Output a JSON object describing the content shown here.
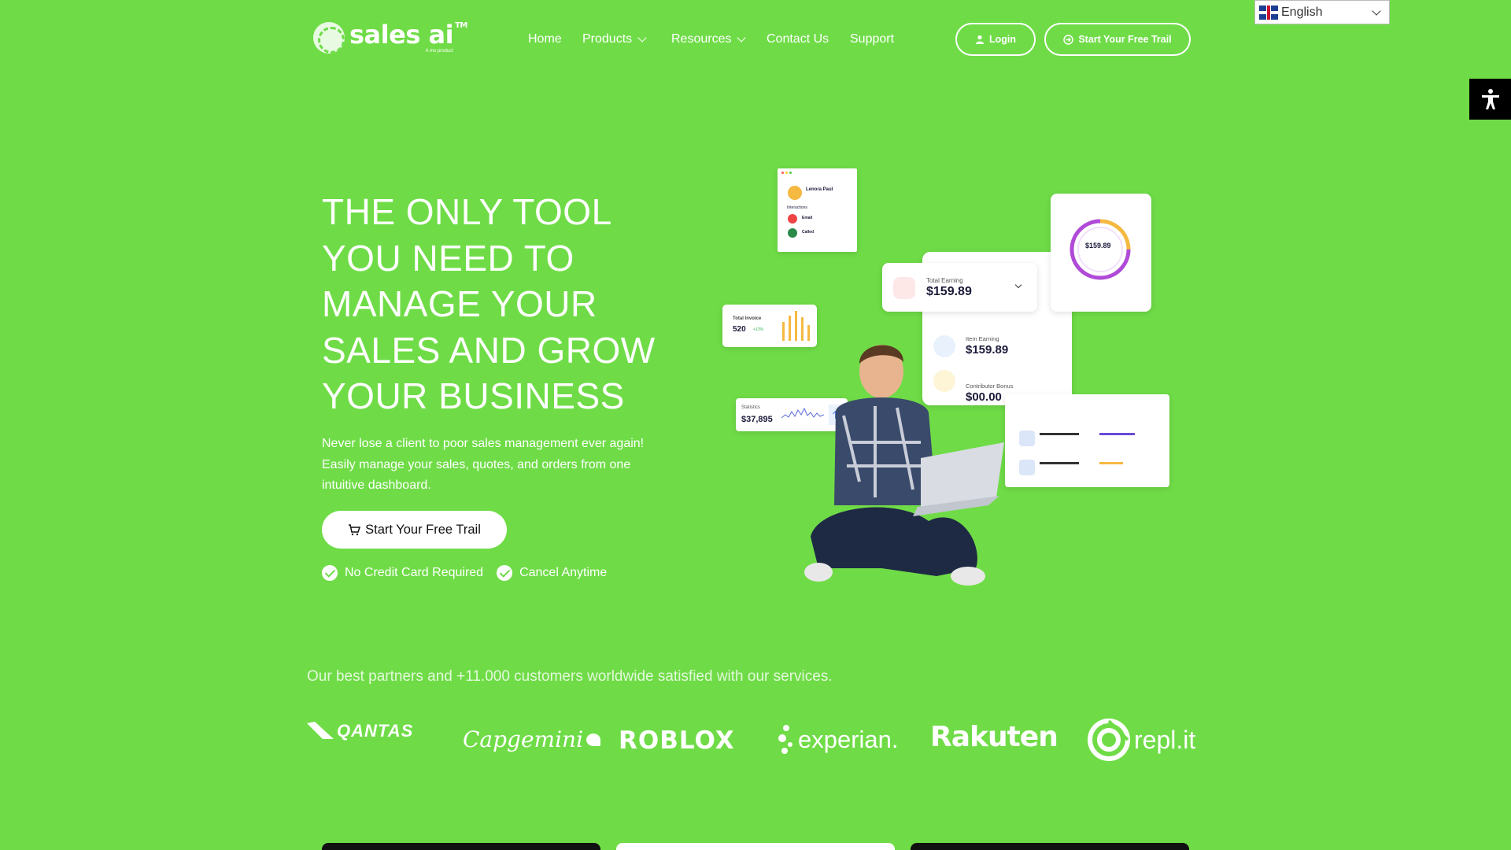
{
  "header": {
    "logo_name": "sales ai",
    "logo_tm": "TM",
    "logo_sub": "A mo product",
    "nav": [
      {
        "label": "Home",
        "dropdown": false
      },
      {
        "label": "Products",
        "dropdown": true
      },
      {
        "label": "Resources",
        "dropdown": true
      },
      {
        "label": "Contact Us",
        "dropdown": false
      },
      {
        "label": "Support",
        "dropdown": false
      }
    ],
    "login_label": "Login",
    "trial_label": "Start Your Free Trail"
  },
  "language": {
    "selected": "English"
  },
  "hero": {
    "title_lines": [
      "THE ONLY TOOL",
      "YOU NEED TO",
      "MANAGE YOUR",
      "SALES AND GROW",
      "YOUR BUSINESS"
    ],
    "desc_lines": [
      "Never lose a client to poor sales management ever again!",
      "Easily manage your sales, quotes, and orders from one",
      "intuitive dashboard."
    ],
    "cta_label": "Start Your Free Trail",
    "perks": [
      "No Credit Card Required",
      "Cancel Anytime"
    ]
  },
  "illustration": {
    "contact_name": "Lenora Paul",
    "interactions_label": "Interactions",
    "email_label": "Email",
    "called_label": "Called",
    "total_earning_label": "Total Earning",
    "total_earning_value": "$159.89",
    "donut_value": "$159.89",
    "total_invoice_label": "Total Invoice",
    "total_invoice_value": "520",
    "total_invoice_change": "+12%",
    "item_earning_label": "Item Earning",
    "item_earning_value": "$159.89",
    "contributor_bonus_label": "Contributor Bonus",
    "contributor_bonus_value": "$00.00",
    "statistics_label": "Statistics",
    "statistics_value": "$37,895"
  },
  "partners": {
    "text": "Our best partners and +11.000 customers worldwide satisfied with our services.",
    "logos": [
      "QANTAS",
      "Capgemini",
      "ROBLOX",
      "experian.",
      "Rakuten",
      "repl.it"
    ]
  },
  "colors": {
    "background": "#6fdc47",
    "white": "#ffffff"
  }
}
